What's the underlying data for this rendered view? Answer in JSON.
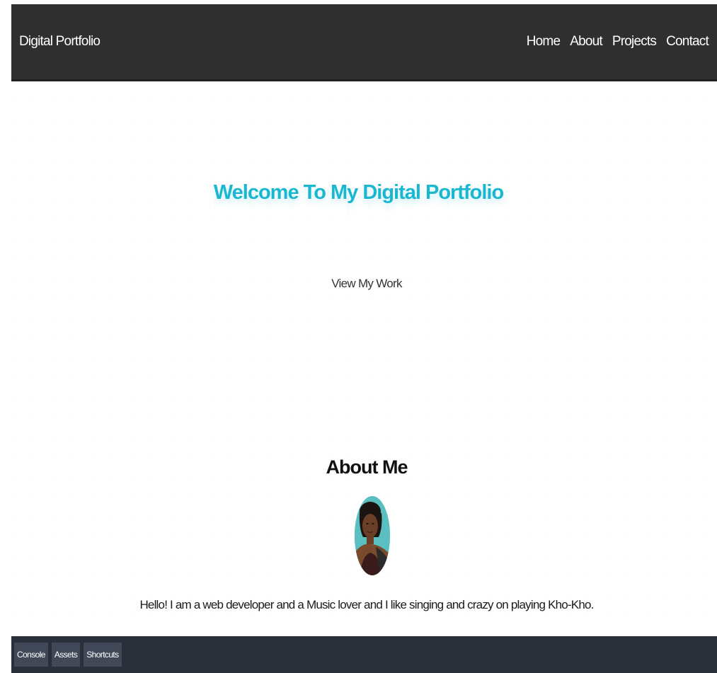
{
  "navbar": {
    "brand": "Digital Portfolio",
    "links": [
      "Home",
      "About",
      "Projects",
      "Contact"
    ]
  },
  "hero": {
    "title": "Welcome To My Digital Portfolio",
    "button_label": "View My Work"
  },
  "about": {
    "heading": "About Me",
    "text": "Hello! I am a web developer and a Music lover and I like singing and crazy on playing Kho-Kho."
  },
  "bottom_bar": {
    "buttons": [
      "Console",
      "Assets",
      "Shortcuts"
    ]
  },
  "colors": {
    "navbar_bg": "#2f2f2f",
    "hero_title": "#1ab8d0",
    "bottom_bar_bg": "#2a2f3a",
    "bottom_bar_button_bg": "#414857"
  }
}
